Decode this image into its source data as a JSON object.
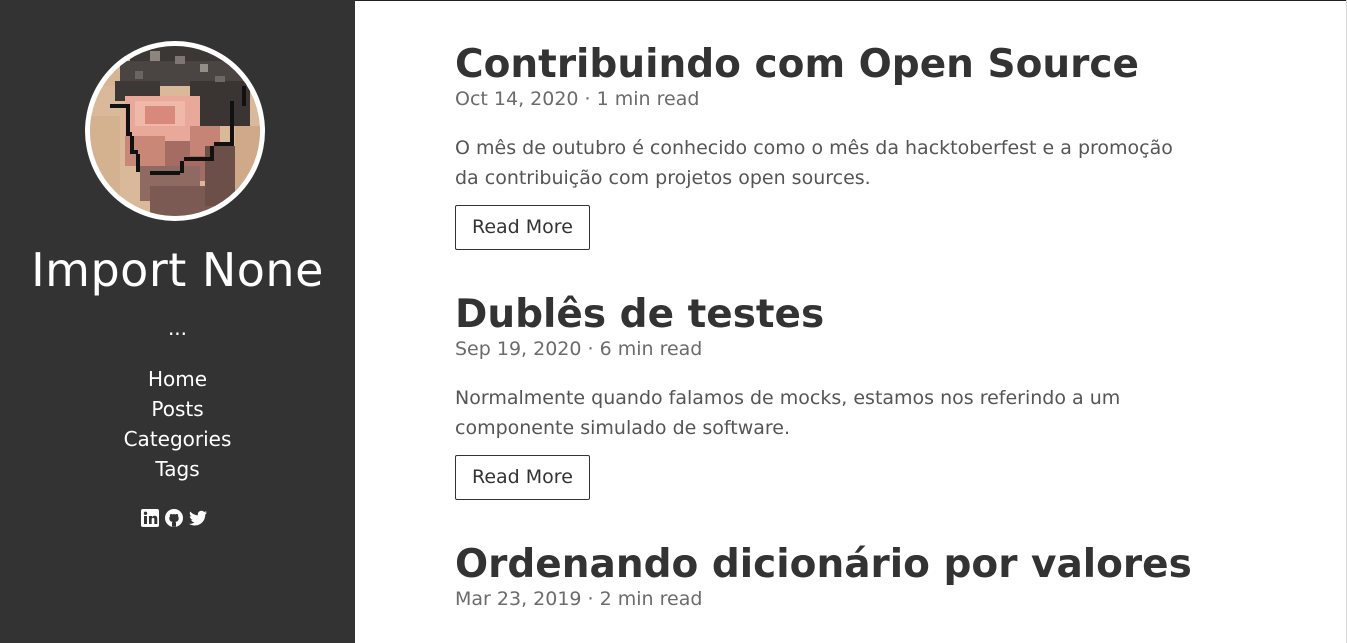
{
  "sidebar": {
    "title": "Import None",
    "description": "...",
    "nav": [
      "Home",
      "Posts",
      "Categories",
      "Tags"
    ],
    "social_icons": [
      "linkedin-icon",
      "github-icon",
      "twitter-icon"
    ],
    "background_color": "#333333"
  },
  "posts": [
    {
      "title": "Contribuindo com Open Source",
      "meta": "Oct 14, 2020 · 1 min read",
      "summary": "O mês de outubro é conhecido como o mês da hacktoberfest e a promoção da contribuição com projetos open sources.",
      "button": "Read More"
    },
    {
      "title": "Dublês de testes",
      "meta": "Sep 19, 2020 · 6 min read",
      "summary": "Normalmente quando falamos de mocks, estamos nos referindo a um componente simulado de software.",
      "button": "Read More"
    },
    {
      "title": "Ordenando dicionário por valores",
      "meta": "Mar 23, 2019 · 2 min read"
    }
  ]
}
